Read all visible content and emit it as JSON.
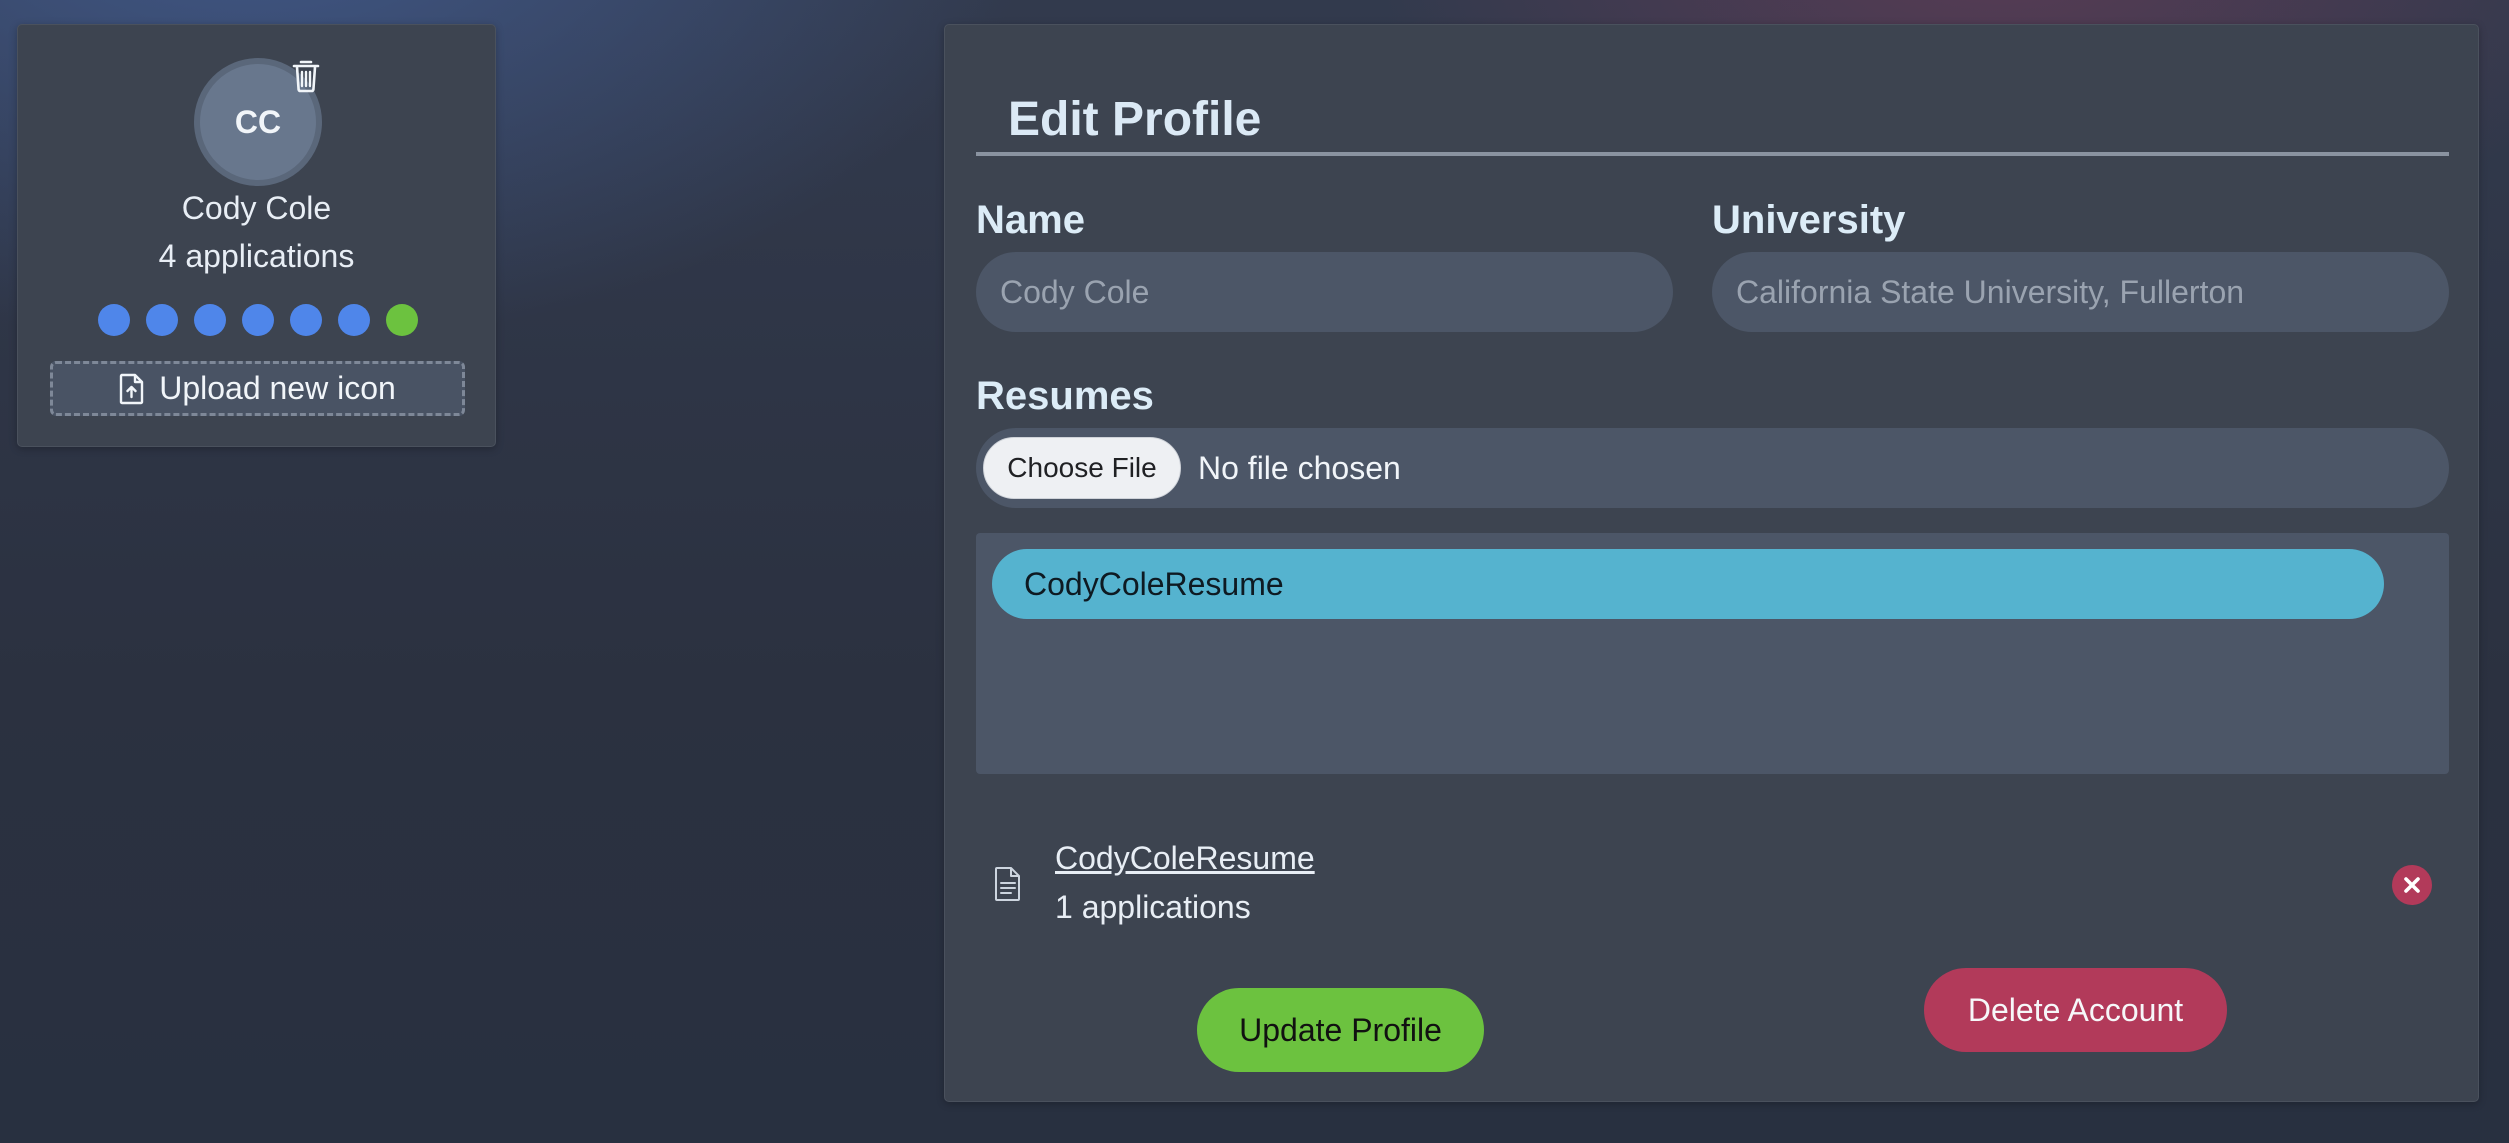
{
  "profile_card": {
    "initials": "CC",
    "name": "Cody Cole",
    "applications": "4 applications",
    "color_options": [
      {
        "color": "#4f86ea",
        "selected": false
      },
      {
        "color": "#4f86ea",
        "selected": false
      },
      {
        "color": "#4f86ea",
        "selected": false
      },
      {
        "color": "#4f86ea",
        "selected": false
      },
      {
        "color": "#4f86ea",
        "selected": false
      },
      {
        "color": "#4f86ea",
        "selected": false
      },
      {
        "color": "#6cc23f",
        "selected": true
      }
    ],
    "upload_label": "Upload new icon",
    "delete_icon": "trash-icon",
    "upload_icon": "file-upload-icon"
  },
  "edit_profile": {
    "title": "Edit Profile",
    "name_label": "Name",
    "name_placeholder": "Cody Cole",
    "university_label": "University",
    "university_placeholder": "California State University, Fullerton",
    "resumes_label": "Resumes",
    "choose_file_label": "Choose File",
    "no_file_text": "No file chosen",
    "resume_chips": [
      "CodyColeResume"
    ],
    "resume_entry": {
      "name": "CodyColeResume",
      "applications": "1 applications",
      "icon": "document-icon",
      "remove_icon": "close-icon"
    },
    "update_button": "Update Profile",
    "delete_button": "Delete Account"
  },
  "colors": {
    "accent_green": "#6cc23f",
    "accent_red": "#b23a5a",
    "chip_blue": "#55b3cf",
    "panel": "#3d4450"
  }
}
